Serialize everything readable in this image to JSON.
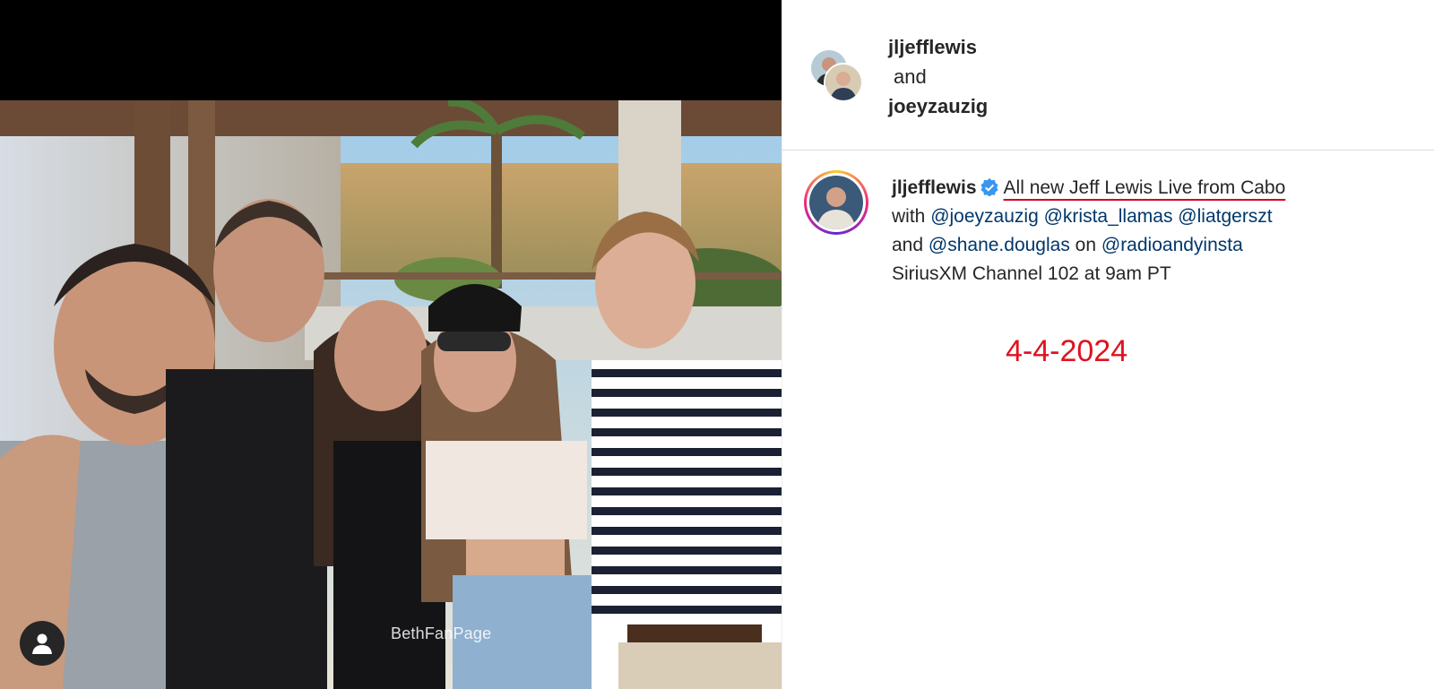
{
  "photo": {
    "watermark": "BethFanPage",
    "user_tag_icon": "user-silhouette-icon"
  },
  "header": {
    "user1": "jljefflewis",
    "conjunction": "and",
    "user2": "joeyzauzig"
  },
  "caption": {
    "username": "jljefflewis",
    "verified_icon": "verified-badge-icon",
    "headline": "All new Jeff Lewis Live from Cabo",
    "line2_prefix": "with",
    "mention1": "@joeyzauzig",
    "mention2": "@krista_llamas",
    "mention3": "@liatgerszt",
    "line3_prefix": "and",
    "mention4": "@shane.douglas",
    "line3_mid": "on",
    "mention5": "@radioandyinsta",
    "line4": "SiriusXM Channel 102 at 9am PT"
  },
  "annotation": {
    "date": "4-4-2024"
  },
  "colors": {
    "annotation_red": "#e0121f",
    "mention_blue": "#00376b",
    "verified_blue": "#3897f0"
  }
}
